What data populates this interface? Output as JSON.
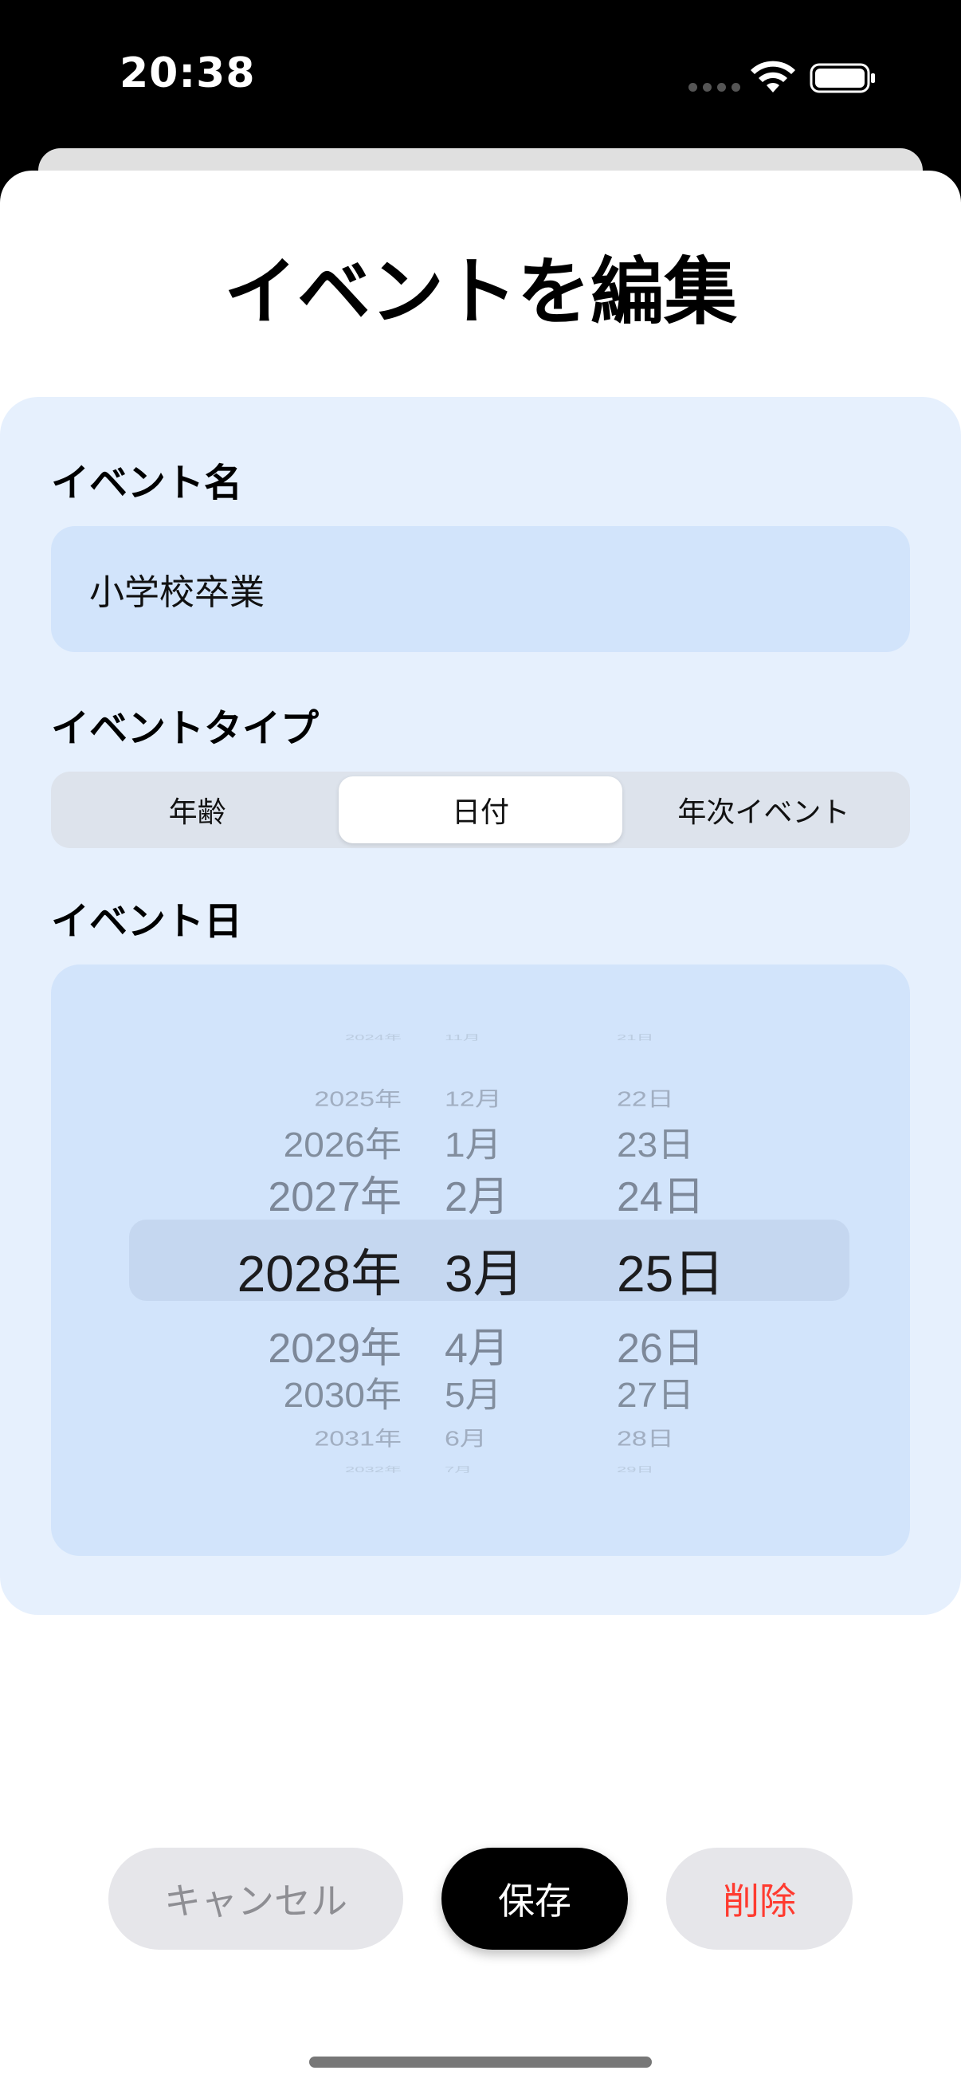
{
  "status_bar": {
    "time": "20:38"
  },
  "title": "イベントを編集",
  "form": {
    "event_name_label": "イベント名",
    "event_name_value": "小学校卒業",
    "event_type_label": "イベントタイプ",
    "event_type_options": [
      "年齢",
      "日付",
      "年次イベント"
    ],
    "event_type_selected": "日付",
    "event_date_label": "イベント日"
  },
  "date_picker": {
    "years": [
      "2024年",
      "2025年",
      "2026年",
      "2027年",
      "2028年",
      "2029年",
      "2030年",
      "2031年",
      "2032年"
    ],
    "months": [
      "11月",
      "12月",
      "1月",
      "2月",
      "3月",
      "4月",
      "5月",
      "6月",
      "7月"
    ],
    "days": [
      "21日",
      "22日",
      "23日",
      "24日",
      "25日",
      "26日",
      "27日",
      "28日",
      "29日"
    ],
    "selected": {
      "year": "2028年",
      "month": "3月",
      "day": "25日"
    }
  },
  "buttons": {
    "cancel": "キャンセル",
    "save": "保存",
    "delete": "削除"
  },
  "colors": {
    "form_background": "#e6f0fd",
    "field_background": "#d2e4fb",
    "delete_red": "#ff3b30",
    "primary_black": "#000000"
  },
  "icons": [
    "wifi-icon",
    "battery-icon"
  ]
}
